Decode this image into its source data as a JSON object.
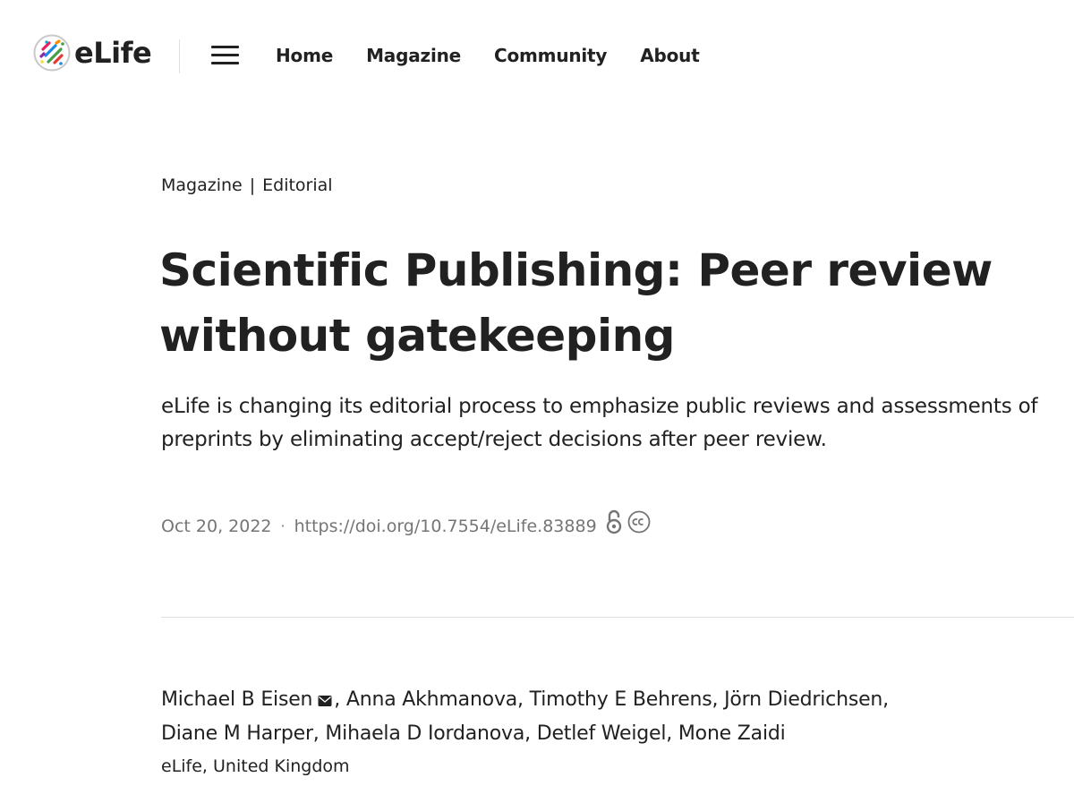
{
  "header": {
    "logo_text": "eLife",
    "nav": [
      {
        "label": "Home"
      },
      {
        "label": "Magazine"
      },
      {
        "label": "Community"
      },
      {
        "label": "About"
      }
    ]
  },
  "article": {
    "kicker_section": "Magazine",
    "kicker_separator": "|",
    "kicker_type": "Editorial",
    "title_line1": "Scientific Publishing: Peer review",
    "title_line2": "without gatekeeping",
    "abstract_line1": "eLife is changing its editorial process to emphasize public reviews and assessments of",
    "abstract_line2": "preprints by eliminating accept/reject decisions after peer review.",
    "date": "Oct 20, 2022",
    "meta_separator": "·",
    "doi": "https://doi.org/10.7554/eLife.83889",
    "authors_line1_first": "Michael B Eisen",
    "authors_line1_rest": ", Anna Akhmanova, Timothy E Behrens, Jörn Diedrichsen,",
    "authors_line2": "Diane M Harper, Mihaela D Iordanova, Detlef Weigel, Mone Zaidi",
    "affiliation": "eLife, United Kingdom"
  },
  "icons": {
    "open_access": "open-lock-icon",
    "license": "creative-commons-icon",
    "email": "envelope-icon",
    "menu": "hamburger-menu-icon"
  },
  "colors": {
    "text": "#212121",
    "muted": "#757575",
    "divider": "#e0e0e0"
  }
}
